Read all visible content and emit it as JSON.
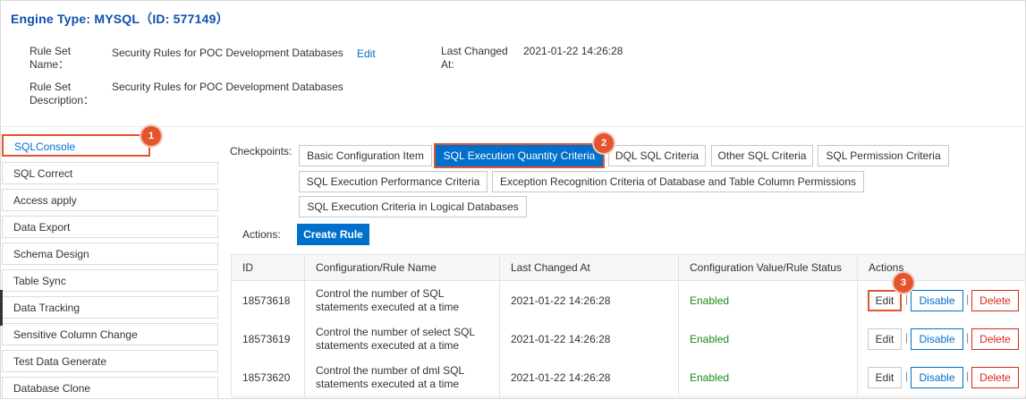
{
  "engine": {
    "title": "Engine Type: MYSQL（ID: 577149）"
  },
  "info": {
    "rule_set_name_label_1": "Rule Set",
    "rule_set_name_label_2": "Name：",
    "rule_set_name_value": "Security Rules for POC Development Databases",
    "edit_link": "Edit",
    "last_changed_label_1": "Last Changed",
    "last_changed_label_2": "At:",
    "last_changed_value": "2021-01-22 14:26:28",
    "rule_set_desc_label_1": "Rule Set",
    "rule_set_desc_label_2": "Description：",
    "rule_set_desc_value": "Security Rules for POC Development Databases"
  },
  "sidebar": {
    "items": [
      {
        "label": "SQLConsole"
      },
      {
        "label": "SQL Correct"
      },
      {
        "label": "Access apply"
      },
      {
        "label": "Data Export"
      },
      {
        "label": "Schema Design"
      },
      {
        "label": "Table Sync"
      },
      {
        "label": "Data Tracking"
      },
      {
        "label": "Sensitive Column Change"
      },
      {
        "label": "Test Data Generate"
      },
      {
        "label": "Database Clone"
      }
    ],
    "active_index": 0
  },
  "badges": {
    "b1": "1",
    "b2": "2",
    "b3": "3"
  },
  "checkpoints": {
    "label": "Checkpoints:",
    "items": [
      {
        "label": "Basic Configuration Item"
      },
      {
        "label": "SQL Execution Quantity Criteria"
      },
      {
        "label": "DQL SQL Criteria"
      },
      {
        "label": "Other SQL Criteria"
      },
      {
        "label": "SQL Permission Criteria"
      },
      {
        "label": "SQL Execution Performance Criteria"
      },
      {
        "label": "Exception Recognition Criteria of Database and Table Column Permissions"
      },
      {
        "label": "SQL Execution Criteria in Logical Databases"
      }
    ],
    "selected_index": 1
  },
  "actions": {
    "label": "Actions:",
    "create_button": "Create Rule"
  },
  "table": {
    "headers": [
      "ID",
      "Configuration/Rule Name",
      "Last Changed At",
      "Configuration Value/Rule Status",
      "Actions"
    ],
    "rows": [
      {
        "id": "18573618",
        "name": "Control the number of SQL statements executed at a time",
        "changed": "2021-01-22 14:26:28",
        "status": "Enabled"
      },
      {
        "id": "18573619",
        "name": "Control the number of select SQL statements executed at a time",
        "changed": "2021-01-22 14:26:28",
        "status": "Enabled"
      },
      {
        "id": "18573620",
        "name": "Control the number of dml SQL statements executed at a time",
        "changed": "2021-01-22 14:26:28",
        "status": "Enabled"
      }
    ],
    "row_actions": {
      "edit": "Edit",
      "separator": "|",
      "disable": "Disable",
      "delete": "Delete"
    }
  },
  "colors": {
    "accent": "#0070cc",
    "highlight": "#e4542e",
    "enabled": "#1a8a1a",
    "danger": "#d9281e"
  }
}
